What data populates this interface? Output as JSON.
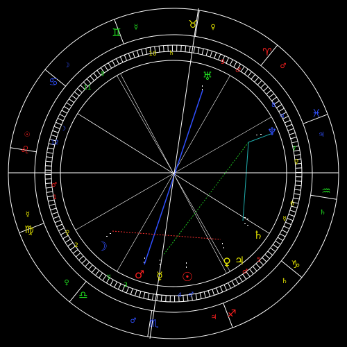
{
  "colors": {
    "background": "#000000",
    "ring_lines": "#ffffff",
    "fire": "#ff2020",
    "earth": "#e0e000",
    "air": "#20e020",
    "water": "#3050ff",
    "aspect_square": "#ff3030",
    "aspect_trine": "#20c020",
    "aspect_opposition": "#3050ff",
    "aspect_sextile": "#20b0b0"
  },
  "signs": [
    {
      "name": "aries",
      "glyph": "♈",
      "ruler": "♂",
      "color": "#ff2020"
    },
    {
      "name": "taurus",
      "glyph": "♉",
      "ruler": "♀",
      "color": "#e0e000"
    },
    {
      "name": "gemini",
      "glyph": "♊",
      "ruler": "☿",
      "color": "#20e020"
    },
    {
      "name": "cancer",
      "glyph": "♋",
      "ruler": "☽",
      "color": "#3050ff"
    },
    {
      "name": "leo",
      "glyph": "♌",
      "ruler": "☉",
      "color": "#ff2020"
    },
    {
      "name": "virgo",
      "glyph": "♍",
      "ruler": "☿",
      "color": "#e0e000"
    },
    {
      "name": "libra",
      "glyph": "♎",
      "ruler": "♀",
      "color": "#20e020"
    },
    {
      "name": "scorpio",
      "glyph": "♏",
      "ruler": "♂",
      "color": "#3050ff"
    },
    {
      "name": "sagittarius",
      "glyph": "♐",
      "ruler": "♃",
      "color": "#ff2020"
    },
    {
      "name": "capricorn",
      "glyph": "♑",
      "ruler": "♄",
      "color": "#e0e000"
    },
    {
      "name": "aquarius",
      "glyph": "♒",
      "ruler": "♄",
      "color": "#20e020"
    },
    {
      "name": "pisces",
      "glyph": "♓",
      "ruler": "♃",
      "color": "#3050ff"
    }
  ],
  "houses": [
    {
      "number": "1",
      "color": "#ff2020"
    },
    {
      "number": "2",
      "color": "#e0e000"
    },
    {
      "number": "3",
      "color": "#20e020"
    },
    {
      "number": "4",
      "color": "#3050ff"
    },
    {
      "number": "5",
      "color": "#ff2020"
    },
    {
      "number": "6",
      "color": "#e0e000"
    },
    {
      "number": "7",
      "color": "#20e020"
    },
    {
      "number": "8",
      "color": "#3050ff"
    },
    {
      "number": "9",
      "color": "#ff2020"
    },
    {
      "number": "10",
      "color": "#e0e000"
    },
    {
      "number": "11",
      "color": "#20e020"
    },
    {
      "number": "12",
      "color": "#3050ff"
    }
  ],
  "planets": [
    {
      "name": "uranus",
      "glyph": "♅",
      "color": "#20e020"
    },
    {
      "name": "neptune",
      "glyph": "♆",
      "color": "#3050ff"
    },
    {
      "name": "saturn",
      "glyph": "♄",
      "color": "#e0e000"
    },
    {
      "name": "jupiter",
      "glyph": "♃",
      "color": "#e0e000"
    },
    {
      "name": "venus",
      "glyph": "♀",
      "color": "#e0e000"
    },
    {
      "name": "sun",
      "glyph": "☉",
      "color": "#ff2020"
    },
    {
      "name": "mercury",
      "glyph": "☿",
      "color": "#e0e000"
    },
    {
      "name": "mars",
      "glyph": "♂",
      "color": "#ff2020"
    },
    {
      "name": "moon",
      "glyph": "☽",
      "color": "#3050ff"
    }
  ]
}
